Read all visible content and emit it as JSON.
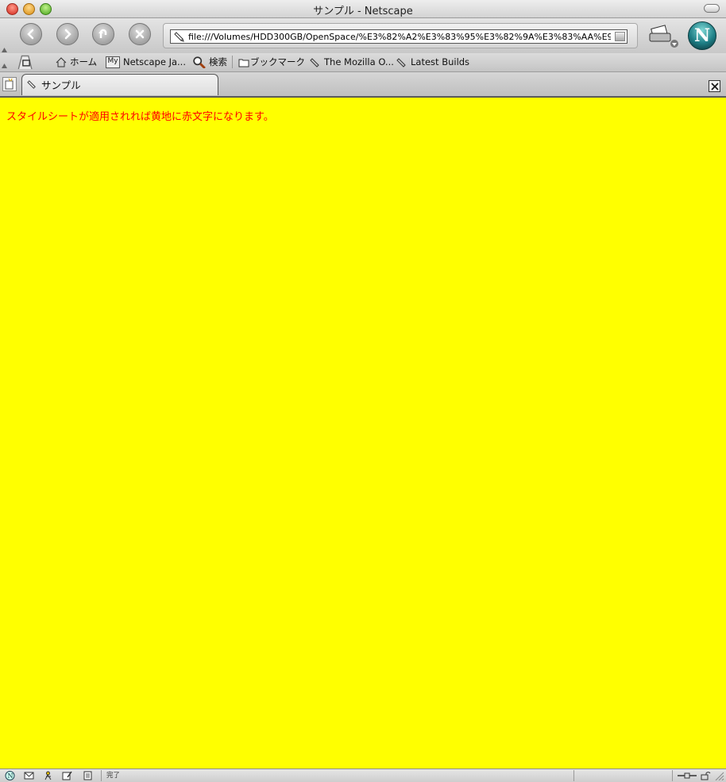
{
  "window": {
    "title": "サンプル - Netscape"
  },
  "toolbar": {
    "url": "file:///Volumes/HDD300GB/OpenSpace/%E3%82%A2%E3%83%95%E3%82%9A%E3%83%AA%E9"
  },
  "bookmarks": {
    "items": [
      {
        "label": "ホーム",
        "icon": "home-icon"
      },
      {
        "label": "Netscape Ja...",
        "icon": "my-icon"
      },
      {
        "label": "検索",
        "icon": "search-icon"
      },
      {
        "label": "ブックマーク",
        "icon": "folder-icon"
      },
      {
        "label": "The Mozilla O...",
        "icon": "bookmark-icon"
      },
      {
        "label": "Latest Builds",
        "icon": "bookmark-icon"
      }
    ],
    "my_badge": "My"
  },
  "tabs": [
    {
      "label": "サンプル",
      "active": true
    }
  ],
  "page": {
    "text": "スタイルシートが適用されれば黄地に赤文字になります。",
    "background": "#ffff00",
    "text_color": "#ff0000"
  },
  "status": {
    "text": "完了"
  },
  "logo": {
    "letter": "N"
  }
}
